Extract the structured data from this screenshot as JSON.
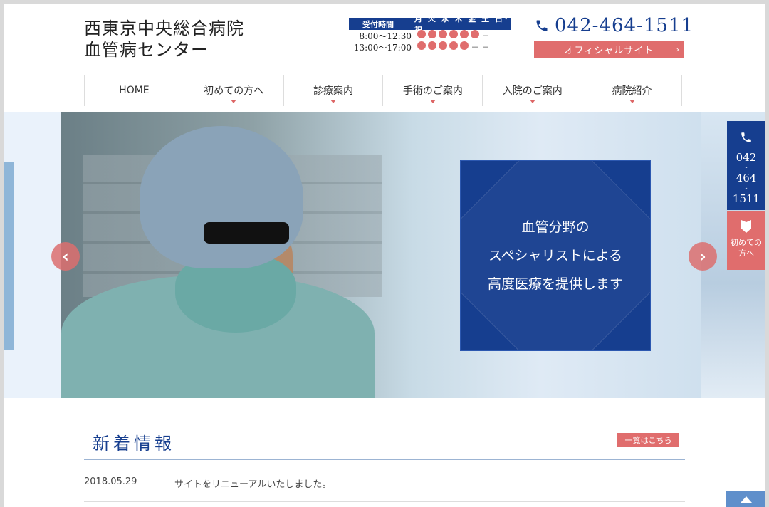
{
  "site": {
    "name_line1": "西東京中央総合病院",
    "name_line2": "血管病センター"
  },
  "hours": {
    "label": "受付時間",
    "days": "月 火 水 木 金 土 日･祝",
    "rows": [
      {
        "time": "8:00～12:30",
        "marks": [
          "dot",
          "dot",
          "dot",
          "dot",
          "dot",
          "dot",
          "dash"
        ]
      },
      {
        "time": "13:00～17:00",
        "marks": [
          "dot",
          "dot",
          "dot",
          "dot",
          "dot",
          "dash",
          "dash"
        ]
      }
    ],
    "dash": "－"
  },
  "contact": {
    "phone": "042-464-1511",
    "phone_icon": "phone-icon",
    "official_label": "オフィシャルサイト",
    "official_arrow": "›"
  },
  "nav": {
    "items": [
      "HOME",
      "初めての方へ",
      "診療案内",
      "手術のご案内",
      "入院のご案内",
      "病院紹介"
    ]
  },
  "hero": {
    "message": [
      "血管分野の",
      "スペシャリストによる",
      "高度医療を提供します"
    ],
    "prev": "‹",
    "next": "›"
  },
  "side": {
    "tel_parts": [
      "042",
      "-",
      "464",
      "-",
      "1511"
    ],
    "first_visit_line1": "初めての",
    "first_visit_line2": "方へ",
    "first_icon": "tag-icon"
  },
  "news": {
    "title": "新着情報",
    "more": "一覧はこちら",
    "items": [
      {
        "date": "2018.05.29",
        "text": "サイトをリニューアルいたしました。"
      }
    ]
  },
  "colors": {
    "navy": "#163e8f",
    "accent": "#e06d6d"
  }
}
